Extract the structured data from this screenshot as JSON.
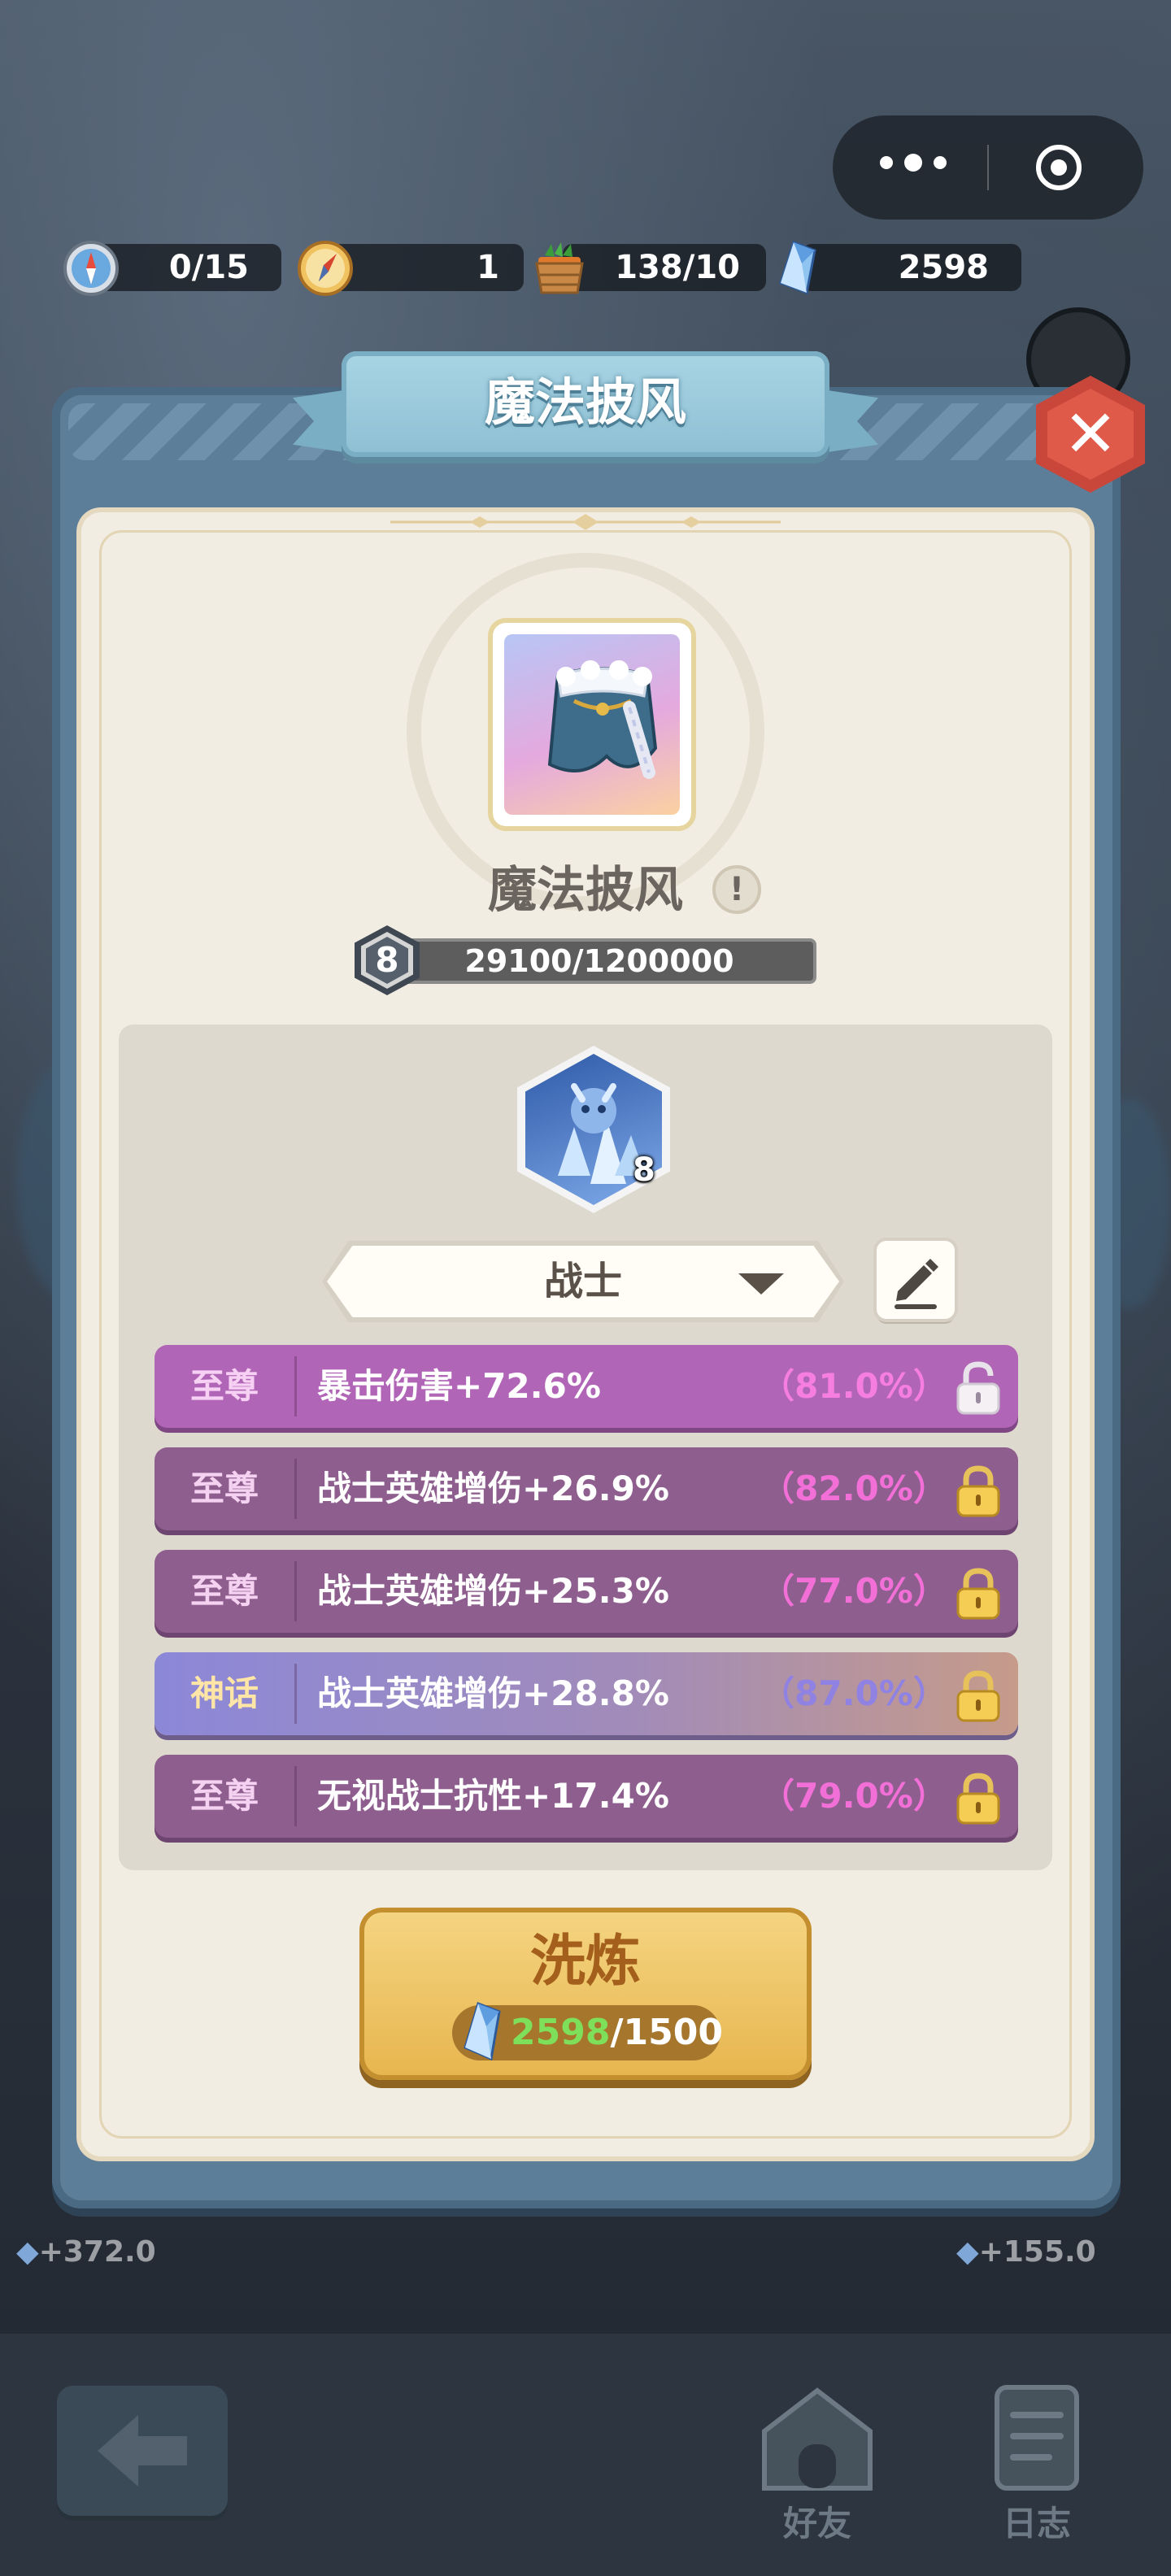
{
  "resources": [
    {
      "icon": "compass-icon",
      "value": "0/15"
    },
    {
      "icon": "compass-gold-icon",
      "value": "1"
    },
    {
      "icon": "carrot-basket-icon",
      "value": "138/10"
    },
    {
      "icon": "crystal-icon",
      "value": "2598"
    }
  ],
  "panel": {
    "title": "魔法披风",
    "close_icon": "close-icon"
  },
  "item": {
    "name": "魔法披风",
    "image": "cape-icon",
    "info_icon": "info-icon",
    "level": "8",
    "progress": "29100/1200000",
    "progress_fraction": 0.02425
  },
  "hero": {
    "icon": "warrior-crystal-icon",
    "level": "8"
  },
  "class_select": {
    "selected": "战士",
    "dropdown_icon": "chevron-down-icon",
    "edit_icon": "edit-icon"
  },
  "attributes": [
    {
      "rarity": "至尊",
      "text": "暴击伤害+72.6%",
      "pct": "（81.0%）",
      "locked": false
    },
    {
      "rarity": "至尊",
      "text": "战士英雄增伤+26.9%",
      "pct": "（82.0%）",
      "locked": true
    },
    {
      "rarity": "至尊",
      "text": "战士英雄增伤+25.3%",
      "pct": "（77.0%）",
      "locked": true
    },
    {
      "rarity": "神话",
      "text": "战士英雄增伤+28.8%",
      "pct": "（87.0%）",
      "locked": true
    },
    {
      "rarity": "至尊",
      "text": "无视战士抗性+17.4%",
      "pct": "（79.0%）",
      "locked": true
    }
  ],
  "refine": {
    "label": "洗炼",
    "have": "2598",
    "cost": "/1500",
    "icon": "crystal-icon"
  },
  "side_gains": {
    "left": "+372.0",
    "right": "+155.0"
  },
  "bottom_nav": {
    "back_icon": "back-arrow-icon",
    "friends": "好友",
    "friends_icon": "house-icon",
    "log": "日志",
    "log_icon": "document-icon"
  },
  "colors": {
    "supreme": "#8e5e8e",
    "myth": "#8c88d8",
    "refine_button": "#e7b54e",
    "panel_frame": "#5d7e98"
  }
}
